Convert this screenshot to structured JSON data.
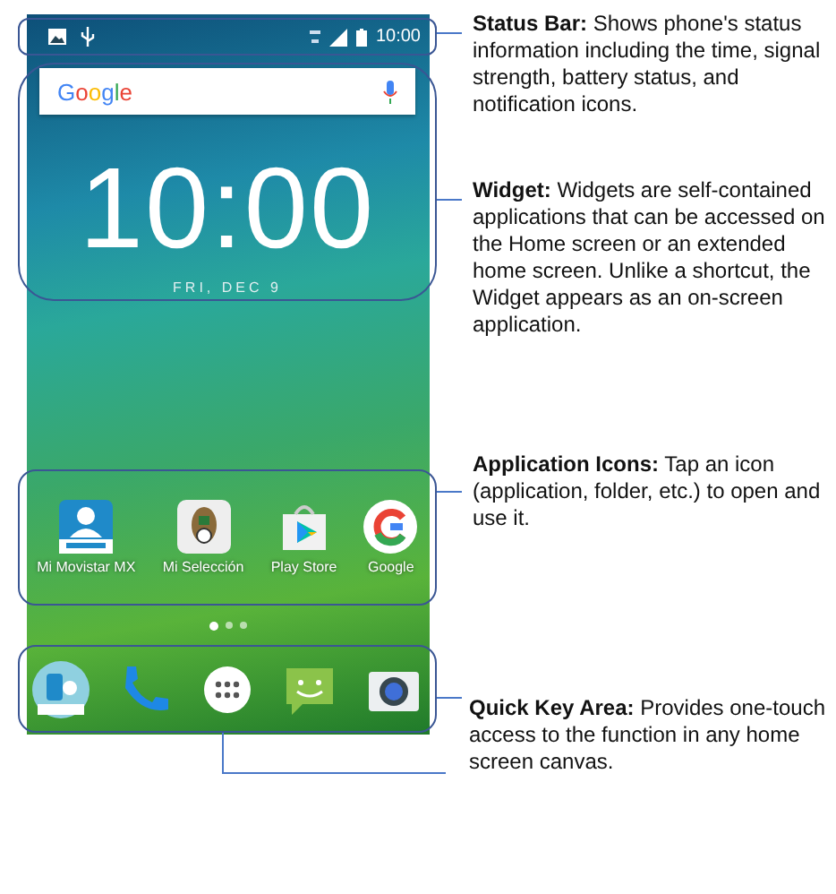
{
  "status_bar": {
    "time": "10:00"
  },
  "search": {
    "logo": "Google"
  },
  "clock": {
    "time": "10:00",
    "date": "FRI, DEC 9"
  },
  "apps": [
    {
      "kind": "person",
      "label": "Mi Movistar MX"
    },
    {
      "kind": "crest",
      "label": "Mi Selección"
    },
    {
      "kind": "play",
      "label": "Play Store"
    },
    {
      "kind": "g",
      "label": "Google"
    }
  ],
  "page_dots": [
    {
      "selected": true
    },
    {
      "selected": false
    },
    {
      "selected": false
    }
  ],
  "dock": [
    {
      "kind": "phone-app"
    },
    {
      "kind": "call"
    },
    {
      "kind": "apps"
    },
    {
      "kind": "message"
    },
    {
      "kind": "camera"
    }
  ],
  "annotations": [
    {
      "kind": "status",
      "title": "Status Bar:",
      "text": "Shows phone's status information including the time, signal strength, battery status, and notification icons."
    },
    {
      "kind": "widget",
      "title": "Widget:",
      "text": "Widgets are self-contained applications that can be accessed on the Home screen or an extended home screen. Unlike a shortcut, the Widget appears as an on-screen application."
    },
    {
      "kind": "apps",
      "title": "Application Icons:",
      "text": "Tap an icon (application, folder, etc.) to open and use it."
    },
    {
      "kind": "quick",
      "title": "Quick Key Area:",
      "text": "Provides one-touch access to the function in any home screen canvas."
    }
  ]
}
